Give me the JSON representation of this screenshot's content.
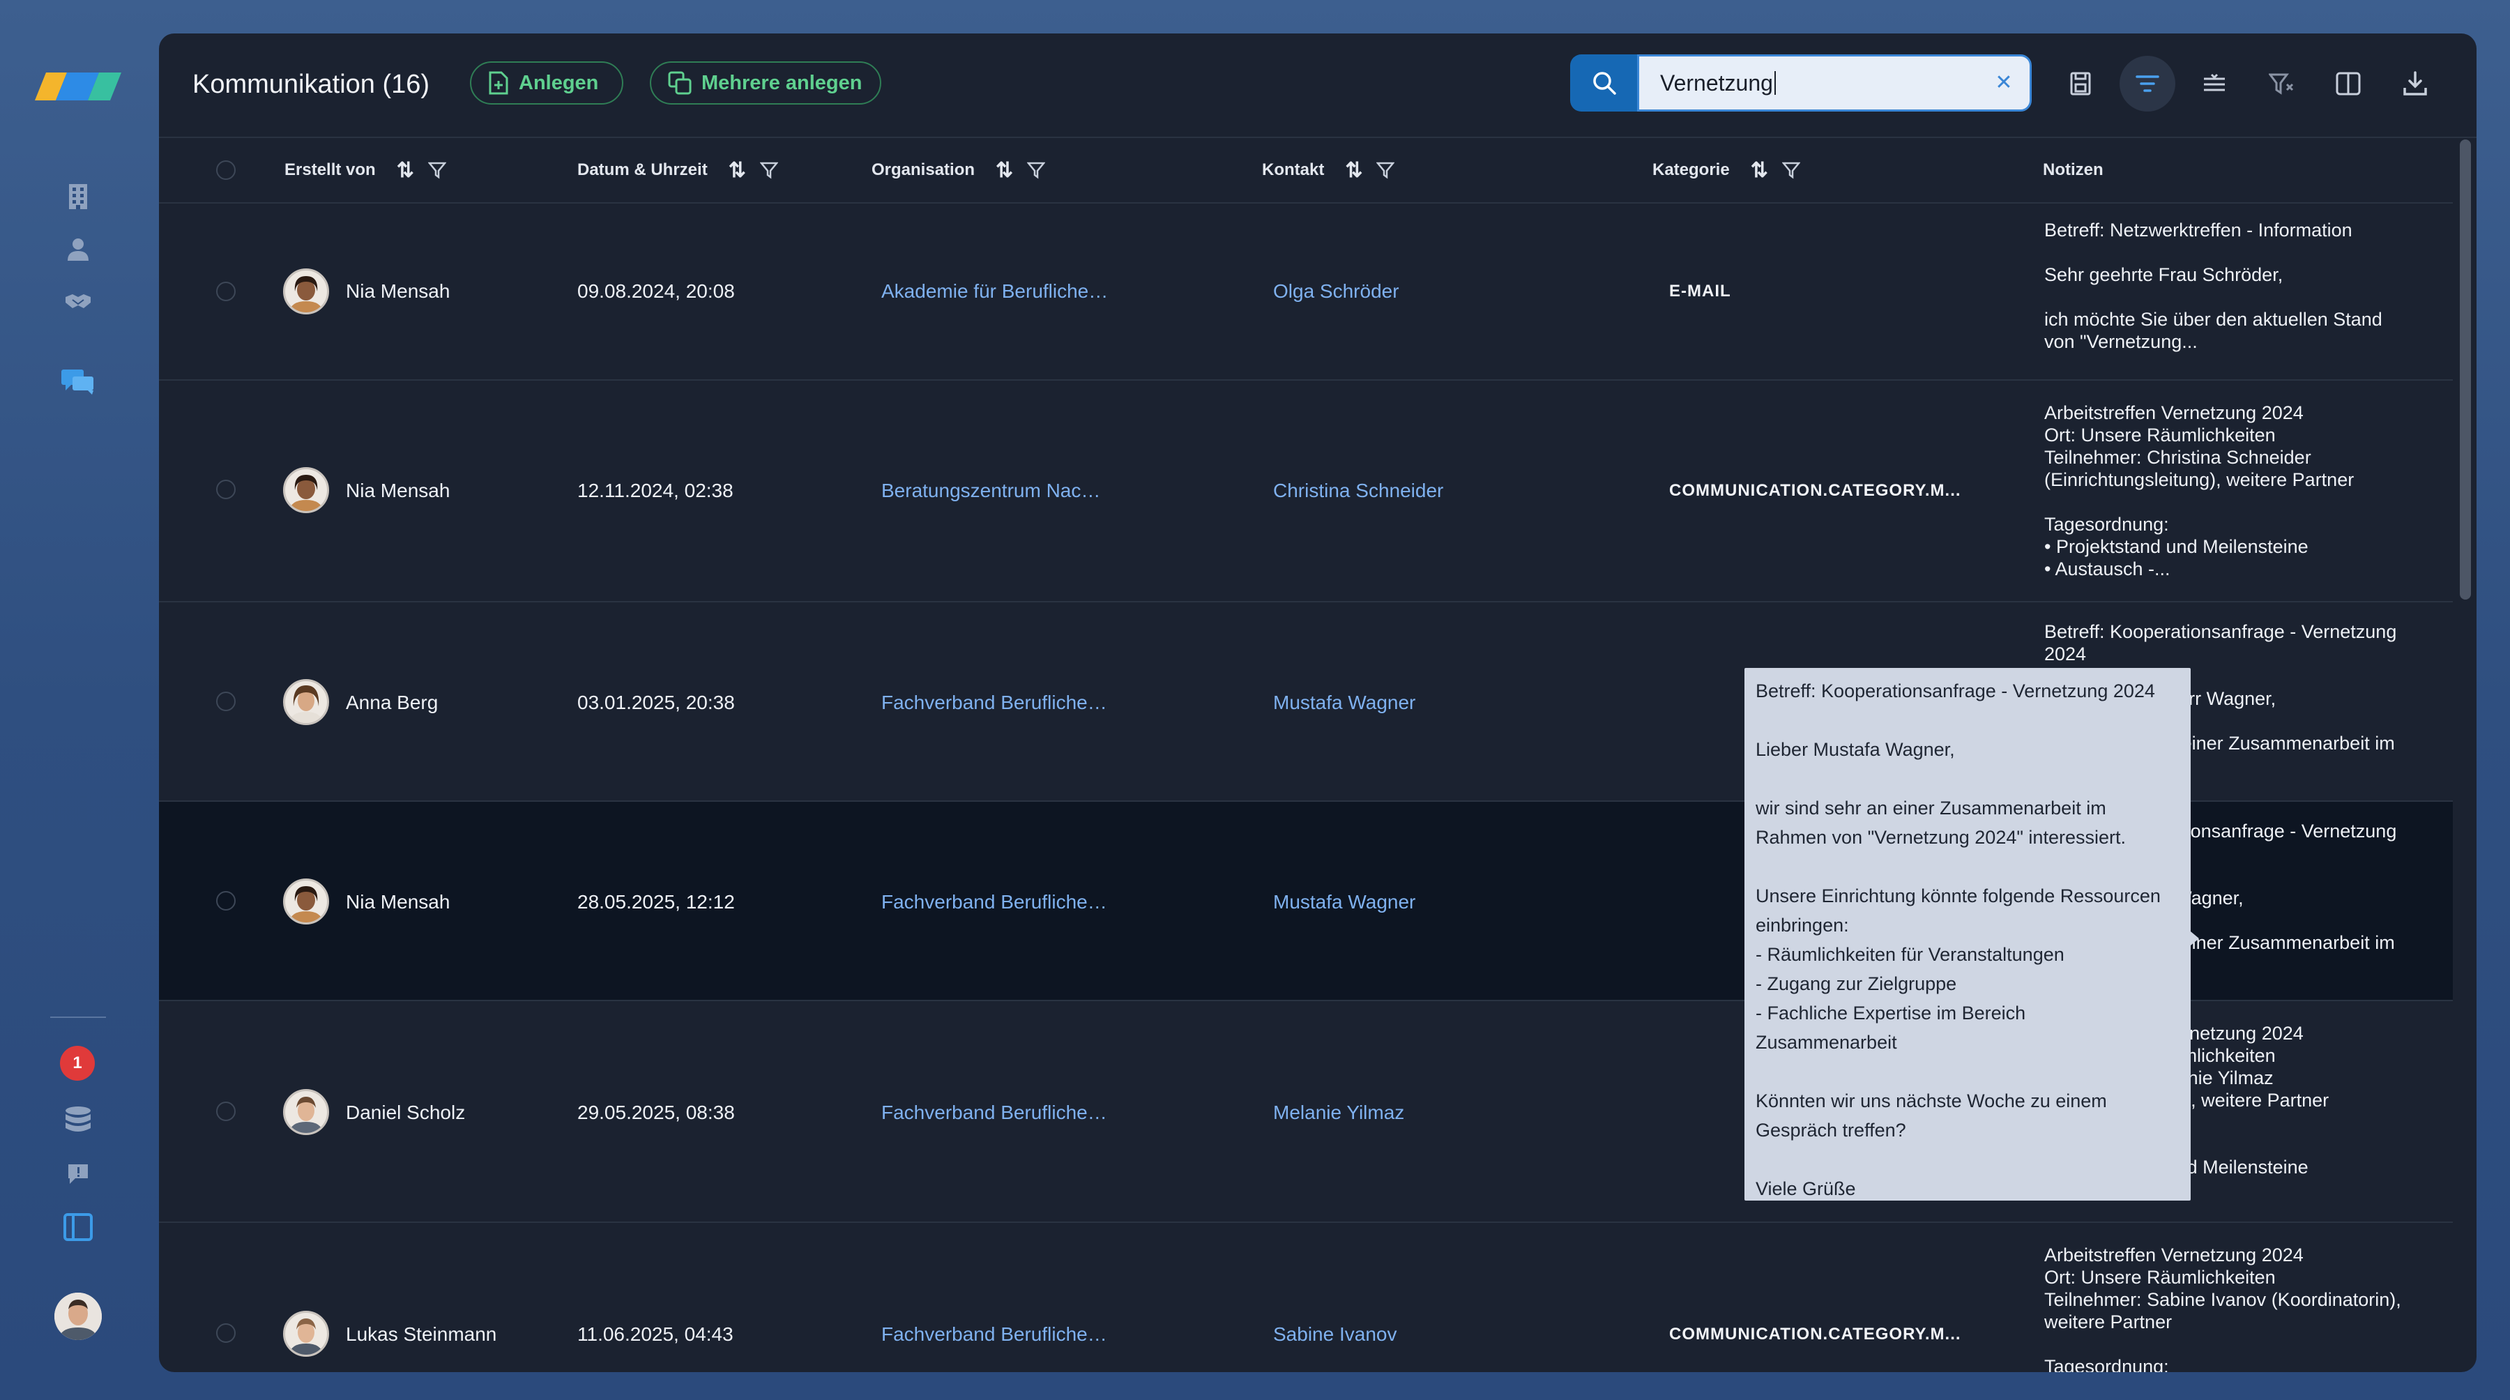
{
  "header": {
    "title": "Kommunikation (16)",
    "create_label": "Anlegen",
    "create_multiple_label": "Mehrere anlegen",
    "search_value": "Vernetzung"
  },
  "columns": {
    "created_by": "Erstellt von",
    "datetime": "Datum & Uhrzeit",
    "organisation": "Organisation",
    "contact": "Kontakt",
    "category": "Kategorie",
    "notes": "Notizen"
  },
  "sidebar": {
    "notification_count": "1",
    "icons": [
      "building-icon",
      "person-icon",
      "handshake-icon",
      "chat-icon",
      "database-icon",
      "feedback-icon",
      "panel-icon"
    ]
  },
  "rows": [
    {
      "author": "Nia Mensah",
      "datetime": "09.08.2024, 20:08",
      "organisation": "Akademie für Berufliche…",
      "contact": "Olga Schröder",
      "category": "E-MAIL",
      "notes": "Betreff: Netzwerktreffen - Information\n\nSehr geehrte Frau Schröder,\n\nich möchte Sie über den aktuellen Stand\nvon \"Vernetzung..."
    },
    {
      "author": "Nia Mensah",
      "datetime": "12.11.2024, 02:38",
      "organisation": "Beratungszentrum Nac…",
      "contact": "Christina Schneider",
      "category": "COMMUNICATION.CATEGORY.M...",
      "notes": "Arbeitstreffen Vernetzung 2024\nOrt: Unsere Räumlichkeiten\nTeilnehmer: Christina Schneider\n(Einrichtungsleitung), weitere Partner\n\nTagesordnung:\n• Projektstand und Meilensteine\n• Austausch -..."
    },
    {
      "author": "Anna Berg",
      "datetime": "03.01.2025, 20:38",
      "organisation": "Fachverband Berufliche…",
      "contact": "Mustafa Wagner",
      "category": "",
      "notes": "Betreff: Kooperationsanfrage - Vernetzung\n2024\n\nSehr geehrter Herr Wagner,\n\nwir sind sehr an einer Zusammenarbeit im\nRahmen..."
    },
    {
      "author": "Nia Mensah",
      "datetime": "28.05.2025, 12:12",
      "organisation": "Fachverband Berufliche…",
      "contact": "Mustafa Wagner",
      "category": "",
      "notes": "Betreff: Kooperationsanfrage - Vernetzung\n2024\n\nLieber Mustafa Wagner,\n\nwir sind sehr an einer Zusammenarbeit im\nRahmen von..."
    },
    {
      "author": "Daniel Scholz",
      "datetime": "29.05.2025, 08:38",
      "organisation": "Fachverband Berufliche…",
      "contact": "Melanie Yilmaz",
      "category": "",
      "notes": "Arbeitstreffen Vernetzung 2024\nOrt: Unsere Räumlichkeiten\nTeilnehmer: Melanie Yilmaz\n(Geschäftsführer), weitere Partner\n\nTagesordnung:\n• Projektstand und Meilensteine\n• Kooperation -..."
    },
    {
      "author": "Lukas Steinmann",
      "datetime": "11.06.2025, 04:43",
      "organisation": "Fachverband Berufliche…",
      "contact": "Sabine Ivanov",
      "category": "COMMUNICATION.CATEGORY.M...",
      "notes": "Arbeitstreffen Vernetzung 2024\nOrt: Unsere Räumlichkeiten\nTeilnehmer: Sabine Ivanov (Koordinatorin),\nweitere Partner\n\nTagesordnung:"
    }
  ],
  "tooltip": {
    "text": "Betreff: Kooperationsanfrage - Vernetzung 2024\n\nLieber Mustafa Wagner,\n\nwir sind sehr an einer Zusammenarbeit im\nRahmen von \"Vernetzung 2024\" interessiert.\n\nUnsere Einrichtung könnte folgende Ressourcen\neinbringen:\n- Räumlichkeiten für Veranstaltungen\n- Zugang zur Zielgruppe\n- Fachliche Expertise im Bereich\nZusammenarbeit\n\nKönnten wir uns nächste Woche zu einem\nGespräch treffen?\n\nViele Grüße"
  },
  "colors": {
    "accent": "#1668b4",
    "green": "#5fd08f",
    "link": "#7fb1ef",
    "badge": "#e03a3a"
  }
}
